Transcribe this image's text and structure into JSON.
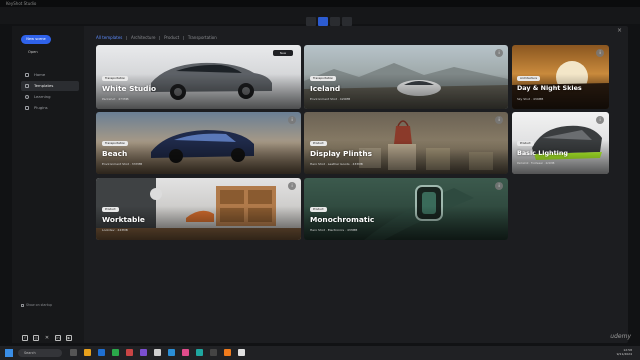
{
  "app": {
    "title": "KeyShot Studio"
  },
  "sidebar": {
    "new_scene": "New scene",
    "open": "Open",
    "nav": [
      {
        "label": "Home",
        "icon": "home-icon",
        "active": false
      },
      {
        "label": "Templates",
        "icon": "grid-icon",
        "active": true
      },
      {
        "label": "Learning",
        "icon": "learning-icon",
        "active": false
      },
      {
        "label": "Plugins",
        "icon": "plugin-icon",
        "active": false
      }
    ],
    "show_on_startup": "Show on startup",
    "socials": [
      "facebook-icon",
      "instagram-icon",
      "x-icon",
      "linkedin-icon",
      "youtube-icon"
    ]
  },
  "tabs": [
    "All templates",
    "Architecture",
    "Product",
    "Transportation"
  ],
  "cards": [
    {
      "tag": "Transportation",
      "title": "White Studio",
      "meta": "Packshot  ·  473MB",
      "badge": "New"
    },
    {
      "tag": "Transportation",
      "title": "Iceland",
      "meta": "Environment Shot  ·  420MB"
    },
    {
      "tag": "Architecture",
      "title": "Day & Night Skies",
      "meta": "Sky Shot  ·  434MB"
    },
    {
      "tag": "Transportation",
      "title": "Beach",
      "meta": "Environment Shot  ·  337MB"
    },
    {
      "tag": "Product",
      "title": "Display Plinths",
      "meta": "Hero Shot  ·  Leather Goods  ·  433MB"
    },
    {
      "tag": "Product",
      "title": "Basic Lighting",
      "meta": "Packshot  ·  Footwear  ·  421MB"
    },
    {
      "tag": "Product",
      "title": "Worktable",
      "meta": "Lookdev  ·  443MB"
    },
    {
      "tag": "Product",
      "title": "Monochromatic",
      "meta": "Hero Shot  ·  Electronics  ·  433MB"
    }
  ],
  "taskbar": {
    "search": "Search",
    "time": "12:58",
    "date": "9/11/2024"
  },
  "watermark": "udemy",
  "colors": {
    "accent": "#2f62ea",
    "active_tab": "#5d8dff",
    "modal_bg": "#1c1d20"
  }
}
